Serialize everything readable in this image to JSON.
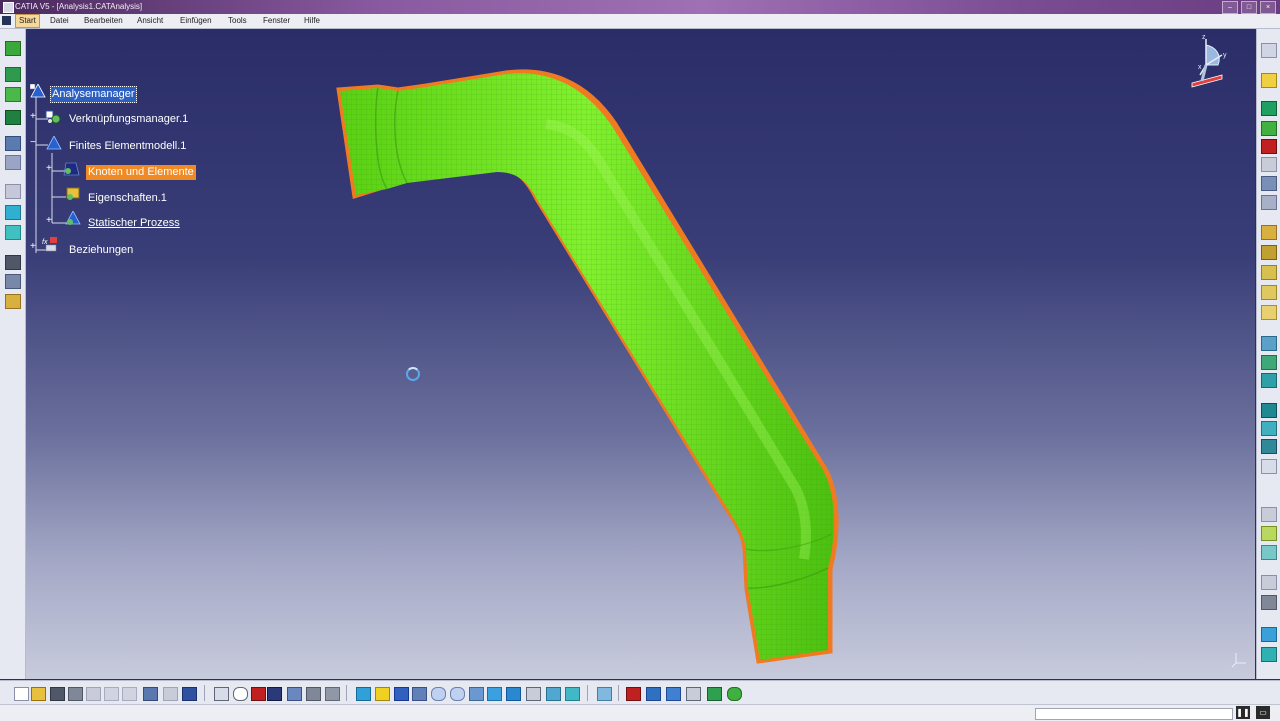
{
  "window": {
    "title": "CATIA V5 - [Analysis1.CATAnalysis]"
  },
  "menu": {
    "items": [
      "Start",
      "Datei",
      "Bearbeiten",
      "Ansicht",
      "Einfügen",
      "Tools",
      "Fenster",
      "Hilfe"
    ],
    "active": "Start"
  },
  "tree": {
    "root": "Analysemanager",
    "nodes": [
      {
        "label": "Verknüpfungsmanager.1",
        "icon": "link-manager-icon"
      },
      {
        "label": "Finites Elementmodell.1",
        "icon": "fem-model-icon"
      },
      {
        "label": "Knoten und Elemente",
        "icon": "nodes-elements-icon",
        "selected": true
      },
      {
        "label": "Eigenschaften.1",
        "icon": "properties-icon"
      },
      {
        "label": "Statischer Prozess",
        "icon": "static-process-icon"
      },
      {
        "label": "Beziehungen",
        "icon": "relations-icon"
      }
    ]
  },
  "compass": {
    "axes": [
      "z",
      "y",
      "x"
    ]
  },
  "colors": {
    "mesh_fill": "#6ee81c",
    "mesh_edge": "#f07a20",
    "tree_selection": "#f08a24",
    "root_selection": "#2d5fc0"
  }
}
